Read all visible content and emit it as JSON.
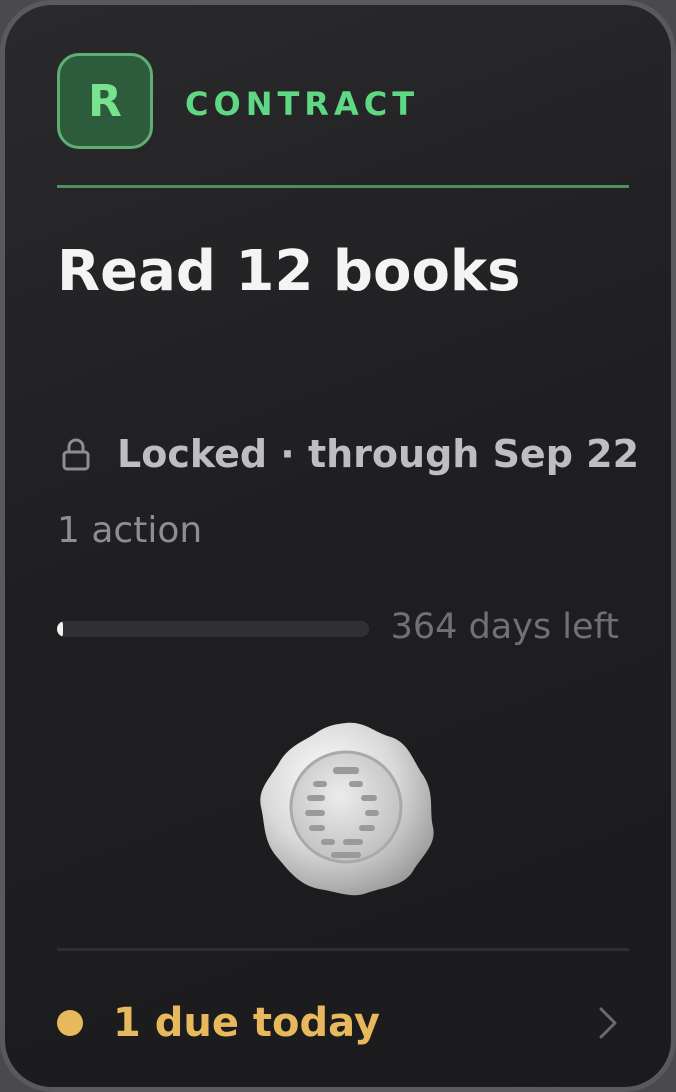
{
  "card": {
    "badge_letter": "R",
    "eyebrow": "CONTRACT",
    "title": "Read 12 books",
    "status": "Locked · through Sep 22",
    "actions": "1 action",
    "progress": {
      "fraction_elapsed": 0.005,
      "days_left_label": "364 days left"
    },
    "footer": {
      "due_label": "1 due today"
    },
    "icons": {
      "status": "lock-icon",
      "seal": "wax-seal-icon",
      "footer": "chevron-right-icon"
    },
    "colors": {
      "accent": "#5fd884",
      "warning": "#e8b95c"
    }
  }
}
